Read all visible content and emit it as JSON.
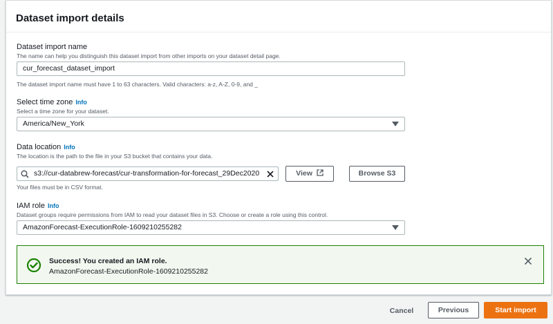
{
  "panel": {
    "title": "Dataset import details"
  },
  "import_name": {
    "label": "Dataset import name",
    "description": "The name can help you distinguish this dataset import from other imports on your dataset detail page.",
    "value": "cur_forecast_dataset_import",
    "constraint": "The dataset import name must have 1 to 63 characters. Valid characters: a-z, A-Z, 0-9, and _"
  },
  "time_zone": {
    "label": "Select time zone",
    "info": "Info",
    "description": "Select a time zone for your dataset.",
    "selected": "America/New_York"
  },
  "data_location": {
    "label": "Data location",
    "info": "Info",
    "description": "The location is the path to the file in your S3 bucket that contains your data.",
    "value": "s3://cur-databrew-forecast/cur-transformation-for-forecast_29Dec2020",
    "view_label": "View",
    "browse_label": "Browse S3",
    "constraint": "Your files must be in CSV format."
  },
  "iam_role": {
    "label": "IAM role",
    "info": "Info",
    "description": "Dataset groups require permissions from IAM to read your dataset files in S3. Choose or create a role using this control.",
    "selected": "AmazonForecast-ExecutionRole-1609210255282"
  },
  "alert": {
    "title": "Success! You created an IAM role.",
    "body": "AmazonForecast-ExecutionRole-1609210255282",
    "color": "#1d8102"
  },
  "footer": {
    "cancel_label": "Cancel",
    "previous_label": "Previous",
    "start_label": "Start import",
    "primary_color": "#ec7211"
  }
}
